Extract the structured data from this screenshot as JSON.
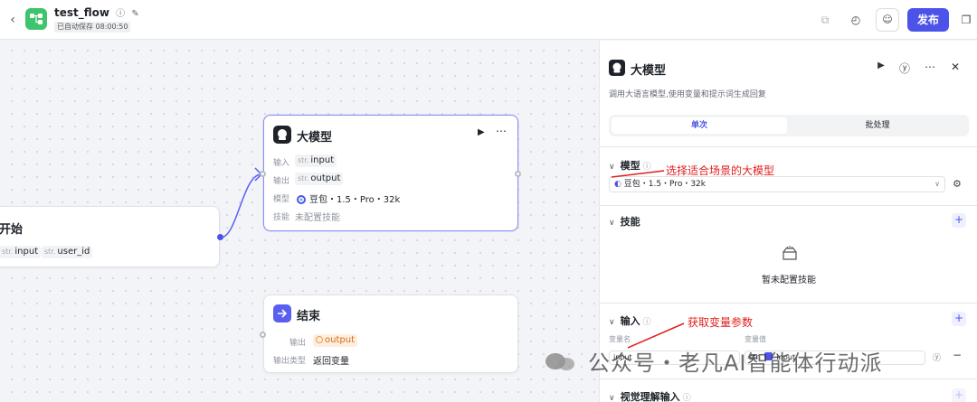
{
  "header": {
    "back_icon": "chevron-left-icon",
    "app_icon": "workflow-icon",
    "title": "test_flow",
    "saved_text": "已自动保存 08:00:50",
    "publish_label": "发布"
  },
  "nodes": {
    "llm": {
      "title": "大模型",
      "input_label": "输入",
      "input_type": "str.",
      "input_name": "input",
      "output_label": "输出",
      "output_type": "str.",
      "output_name": "output",
      "model_label": "模型",
      "model_name": "豆包・1.5・Pro・32k",
      "skill_label": "技能",
      "skill_value": "未配置技能"
    },
    "start": {
      "title": "开始",
      "param1_type": "str.",
      "param1": "input",
      "param2_type": "str.",
      "param2": "user_id"
    },
    "end": {
      "title": "结束",
      "output_label": "输出",
      "output_name": "output",
      "output_type_label": "输出类型",
      "output_type_value": "返回变量"
    }
  },
  "panel": {
    "title": "大模型",
    "description": "调用大语言模型,使用变量和提示词生成回复",
    "tabs": [
      "单次",
      "批处理"
    ],
    "model_section": "模型",
    "model_value": "豆包・1.5・Pro・32k",
    "skills_section": "技能",
    "skills_empty": "暂未配置技能",
    "input_section": "输入",
    "col_var_name": "变量名",
    "col_var_value": "变量值",
    "input_var_name": "input",
    "input_var_type": "str.",
    "input_var_ref": "input",
    "vision_section": "视觉理解输入"
  },
  "annotations": {
    "a1": "选择适合场景的大模型",
    "a2": "获取变量参数"
  },
  "watermark": "公众号・老凡AI智能体行动派",
  "colors": {
    "accent": "#4d53e8",
    "annotation": "#e02020",
    "start_icon": "#3ec46d",
    "end_icon": "#5b5ff0"
  }
}
